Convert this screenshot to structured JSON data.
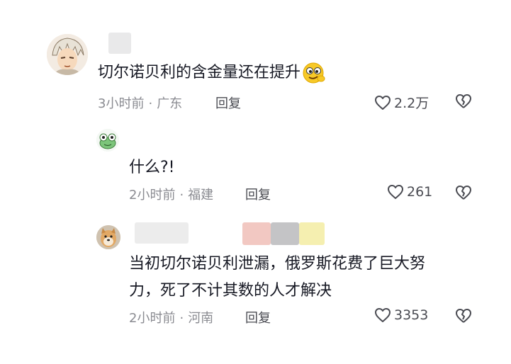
{
  "comments": [
    {
      "text": "切尔诺贝利的含金量还在提升",
      "time": "3小时前",
      "location": "广东",
      "reply_label": "回复",
      "likes": "2.2万",
      "emoji": "squinting-face-emoji"
    },
    {
      "text": "什么?!",
      "time": "2小时前",
      "location": "福建",
      "reply_label": "回复",
      "likes": "261"
    },
    {
      "text_line1": "当初切尔诺贝利泄漏，俄罗斯花费了巨大努",
      "text_line2": "力，死了不计其数的人才解决",
      "time": "2小时前",
      "location": "河南",
      "reply_label": "回复",
      "likes": "3353"
    }
  ],
  "colors": {
    "text": "#161823",
    "meta": "#8a8b91",
    "action": "#4a4b52",
    "blur_pink": "#f2c8c2",
    "blur_gray": "#c4c4c6",
    "blur_yellow": "#f5efb0"
  },
  "icons": {
    "like": "heart-outline-icon",
    "dislike": "broken-heart-icon"
  }
}
